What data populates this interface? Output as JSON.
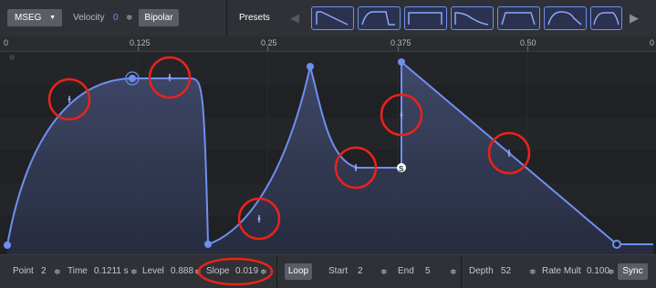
{
  "toolbar": {
    "mode_label": "MSEG",
    "velocity_label": "Velocity",
    "velocity_value": "0",
    "bipolar_label": "Bipolar",
    "presets_label": "Presets",
    "prev_icon": "triangle-left-icon",
    "next_icon": "triangle-right-icon"
  },
  "ruler": {
    "labels": [
      "0",
      "0.125",
      "0.25",
      "0.375",
      "0.50",
      "0"
    ]
  },
  "editor": {
    "sustain_marker": "S",
    "selected_point": 2,
    "highlight_color": "#e8231b",
    "accent_color": "#6f8ff0"
  },
  "bottom": {
    "point_label": "Point",
    "point_value": "2",
    "time_label": "Time",
    "time_value": "0.1211 s",
    "level_label": "Level",
    "level_value": "0.888",
    "slope_label": "Slope",
    "slope_value": "0.019",
    "loop_label": "Loop",
    "start_label": "Start",
    "start_value": "2",
    "end_label": "End",
    "end_value": "5",
    "depth_label": "Depth",
    "depth_value": "52",
    "rate_mult_label": "Rate Mult",
    "rate_mult_value": "0.100",
    "sync_label": "Sync",
    "stepper_icon": "up-down-stepper-icon"
  }
}
